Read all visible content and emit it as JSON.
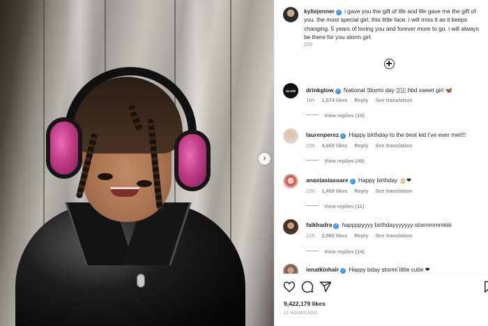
{
  "post": {
    "image_alt": "",
    "next_icon": "chevron-right-icon",
    "caption": {
      "username": "kyliejenner",
      "text": "i gave you the gift of life and life gave me the gift of you. the most special girl. this little face. i will miss it as it keeps changing. 5 years of loving you and forever more to go. i will always be there for you storm girl.",
      "time": "22h"
    },
    "add_icon": "plus-circle-icon",
    "comments": [
      {
        "username": "drinkglow",
        "text": "National Stormi day ▯▯▯ hbd sweet girl 🦋",
        "time": "18h",
        "likes": "1,574 likes",
        "reply": "Reply",
        "translate": "See translation",
        "view_replies": "View replies (10)",
        "avatar_text": "GLOW"
      },
      {
        "username": "laurenperez",
        "text": "Happy birthday to the best kid I've ever met!!!",
        "time": "22h",
        "likes": "4,669 likes",
        "reply": "Reply",
        "translate": "See translation",
        "view_replies": "View replies (48)"
      },
      {
        "username": "anastasiasoare",
        "text": "Happy birthday 🎂❤",
        "time": "22h",
        "likes": "1,469 likes",
        "reply": "Reply",
        "translate": "See translation",
        "view_replies": "View replies (11)"
      },
      {
        "username": "faikhadra",
        "text": "happppyyyy birthdayyyyyyy stormmmmiiiiii",
        "time": "21h",
        "likes": "2,968 likes",
        "reply": "Reply",
        "translate": "See translation",
        "view_replies": "View replies (14)"
      },
      {
        "username": "ienatkinhair",
        "text": "Happy bday stormi little cutie ❤"
      }
    ]
  },
  "actions": {
    "like_icon": "heart-icon",
    "comment_icon": "comment-icon",
    "share_icon": "send-icon",
    "save_icon": "bookmark-icon",
    "likes": "9,422,179 likes",
    "time_ago": "22 HOURS AGO"
  },
  "colors": {
    "verified": "#3897f0",
    "secondary_text": "#8e8e8e",
    "primary_text": "#262626"
  }
}
